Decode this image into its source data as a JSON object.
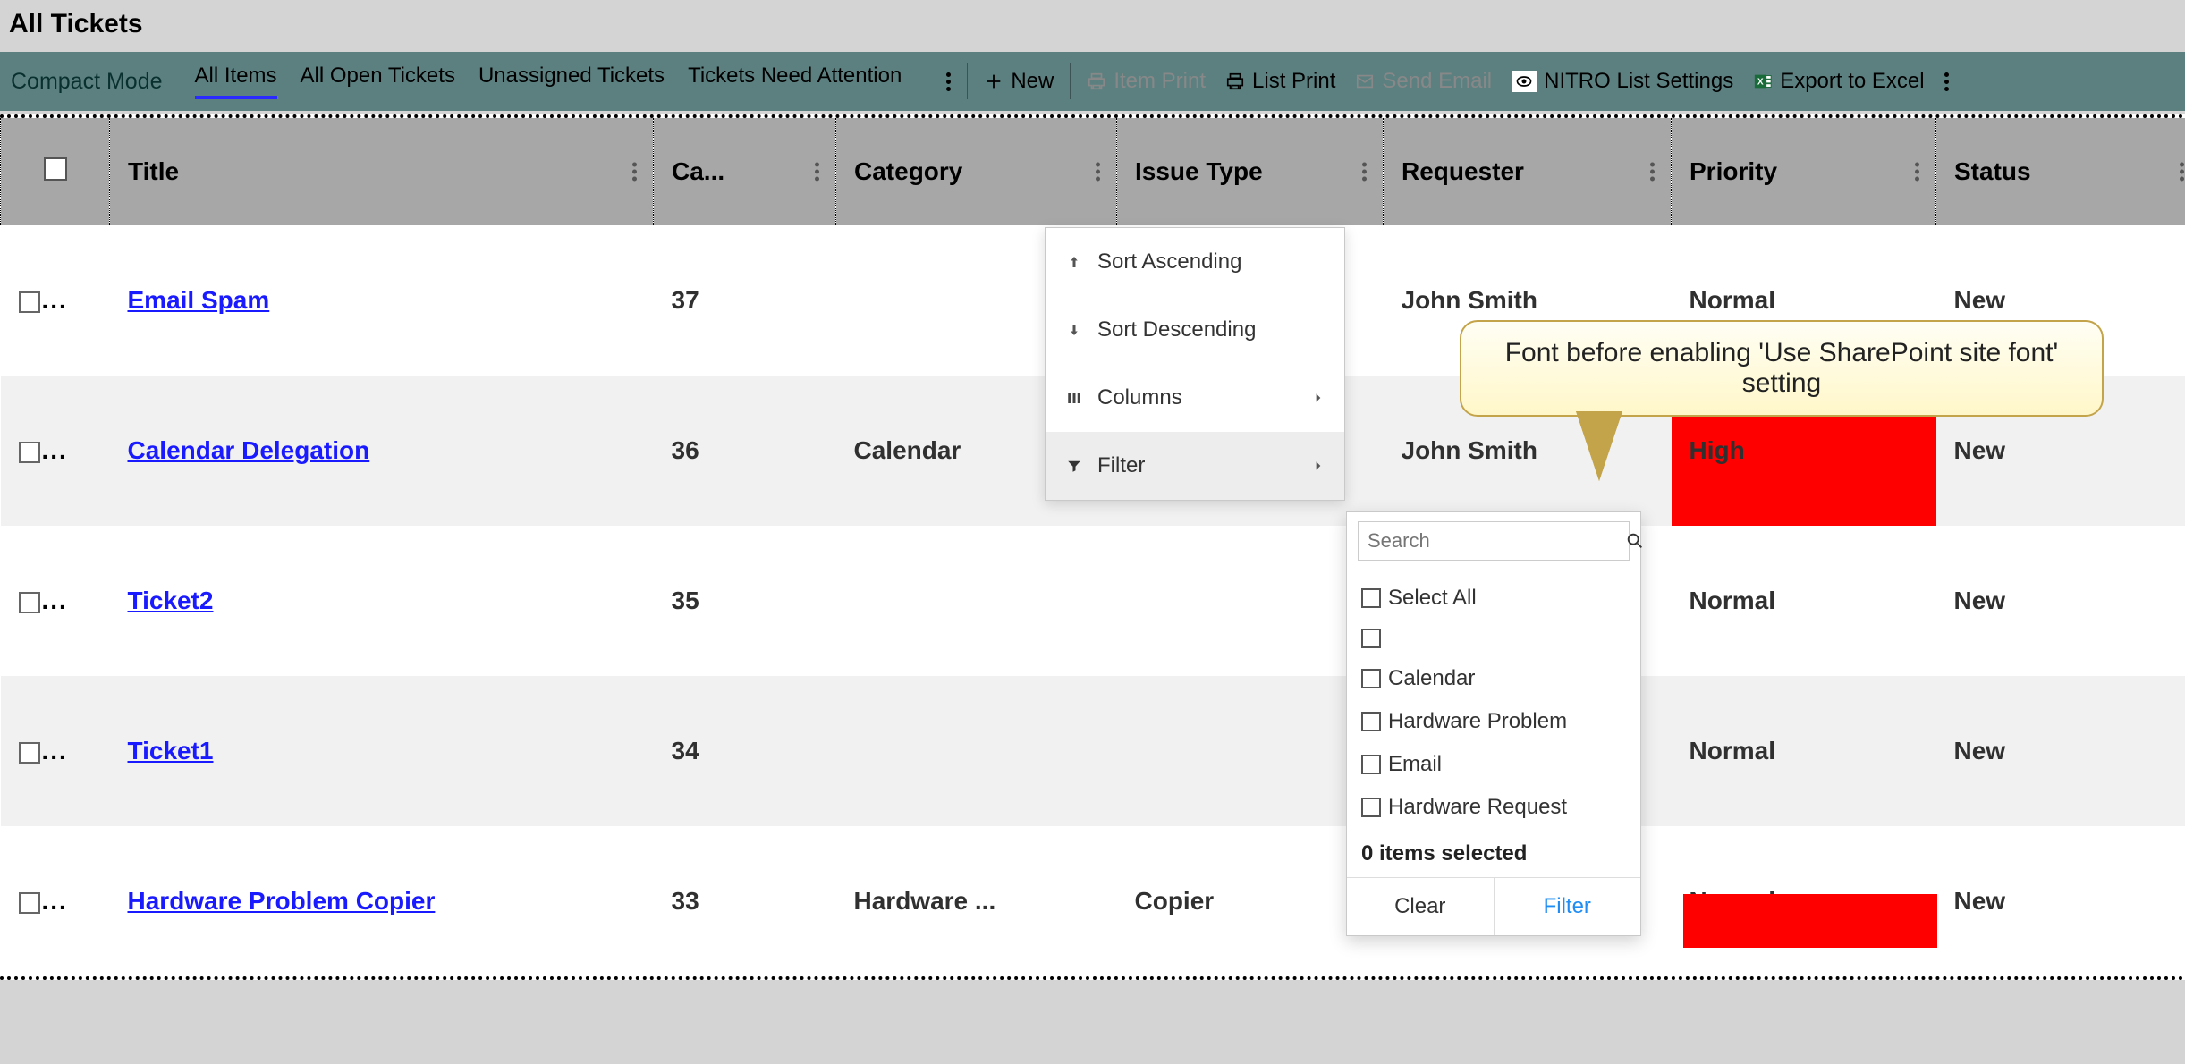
{
  "header": {
    "title": "All Tickets"
  },
  "toolbar": {
    "mode": "Compact Mode",
    "views": [
      "All Items",
      "All Open Tickets",
      "Unassigned Tickets",
      "Tickets Need Attention"
    ],
    "active_view_index": 0,
    "new_label": "New",
    "item_print": "Item Print",
    "list_print": "List Print",
    "send_email": "Send Email",
    "nitro": "NITRO List Settings",
    "export": "Export to Excel"
  },
  "columns": [
    "Title",
    "Ca...",
    "Category",
    "Issue Type",
    "Requester",
    "Priority",
    "Status"
  ],
  "rows": [
    {
      "title": "Email Spam",
      "case": "37",
      "category": "",
      "issue": "",
      "requester": "John Smith",
      "priority": "Normal",
      "status": "New",
      "priority_high": false
    },
    {
      "title": "Calendar Delegation",
      "case": "36",
      "category": "Calendar",
      "issue": "",
      "requester": "John Smith",
      "priority": "High",
      "status": "New",
      "priority_high": true
    },
    {
      "title": "Ticket2",
      "case": "35",
      "category": "",
      "issue": "",
      "requester": "",
      "priority": "Normal",
      "status": "New",
      "priority_high": false
    },
    {
      "title": "Ticket1",
      "case": "34",
      "category": "",
      "issue": "",
      "requester": "",
      "priority": "Normal",
      "status": "New",
      "priority_high": false
    },
    {
      "title": "Hardware Problem Copier",
      "case": "33",
      "category": "Hardware ...",
      "issue": "Copier",
      "requester": "",
      "priority": "Normal",
      "status": "New",
      "priority_high": false
    }
  ],
  "col_menu": {
    "sort_asc": "Sort Ascending",
    "sort_desc": "Sort Descending",
    "columns": "Columns",
    "filter": "Filter"
  },
  "filter": {
    "search_placeholder": "Search",
    "select_all": "Select All",
    "options": [
      "",
      "Calendar",
      "Hardware Problem",
      "Email",
      "Hardware Request"
    ],
    "selected_text": "0 items selected",
    "clear": "Clear",
    "apply": "Filter"
  },
  "callout": {
    "text": "Font before enabling 'Use SharePoint site font' setting"
  }
}
